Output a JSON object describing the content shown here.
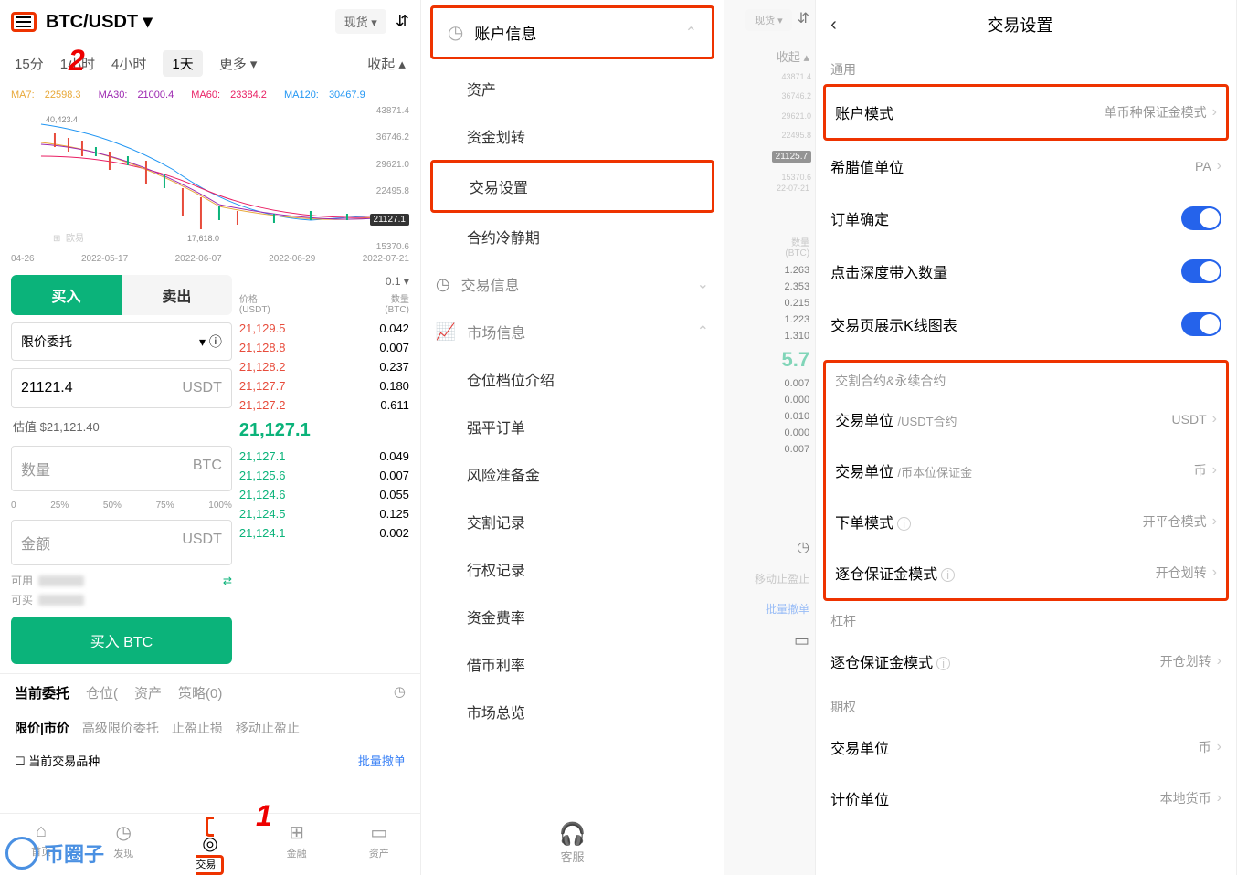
{
  "screen1": {
    "pair": "BTC/USDT ▾",
    "market_type": "现货 ▾",
    "timeframes": [
      "15分",
      "1小时",
      "4小时",
      "1天",
      "更多 ▾"
    ],
    "collapse": "收起 ▴",
    "number_1": "1",
    "number_2": "2",
    "ma": [
      {
        "label": "MA7:",
        "value": "22598.3",
        "color": "#e8a838"
      },
      {
        "label": "MA30:",
        "value": "21000.4",
        "color": "#9c27b0"
      },
      {
        "label": "MA60:",
        "value": "23384.2",
        "color": "#e91e63"
      },
      {
        "label": "MA120:",
        "value": "30467.9",
        "color": "#2196f3"
      }
    ],
    "y_labels": [
      "43871.4",
      "36746.2",
      "29621.0",
      "22495.8",
      "15370.6"
    ],
    "price_tag": "21127.1",
    "chart_high": "40,423.4",
    "chart_low": "17,618.0",
    "watermark_text": "欧易",
    "x_labels": [
      "04-26",
      "2022-05-17",
      "2022-06-07",
      "2022-06-29",
      "2022-07-21"
    ],
    "buy": "买入",
    "sell": "卖出",
    "order_type": "限价委托",
    "price_value": "21121.4",
    "price_unit": "USDT",
    "est_value": "估值 $21,121.40",
    "qty_label": "数量",
    "qty_unit": "BTC",
    "slider_pct": [
      "0",
      "25%",
      "50%",
      "75%",
      "100%"
    ],
    "amount_label": "金额",
    "amount_unit": "USDT",
    "available": "可用",
    "can_buy": "可买",
    "buy_button": "买入 BTC",
    "ob_step": "0.1 ▾",
    "ob_price_label": "价格",
    "ob_price_unit": "(USDT)",
    "ob_qty_label": "数量",
    "ob_qty_unit": "(BTC)",
    "asks": [
      {
        "p": "21,129.5",
        "q": "0.042"
      },
      {
        "p": "21,128.8",
        "q": "0.007"
      },
      {
        "p": "21,128.2",
        "q": "0.237"
      },
      {
        "p": "21,127.7",
        "q": "0.180"
      },
      {
        "p": "21,127.2",
        "q": "0.611"
      }
    ],
    "mid_price": "21,127.1",
    "bids": [
      {
        "p": "21,127.1",
        "q": "0.049"
      },
      {
        "p": "21,125.6",
        "q": "0.007"
      },
      {
        "p": "21,124.6",
        "q": "0.055"
      },
      {
        "p": "21,124.5",
        "q": "0.125"
      },
      {
        "p": "21,124.1",
        "q": "0.002"
      }
    ],
    "bottom_tabs": [
      "当前委托",
      "仓位(",
      "资产",
      "策略(0)"
    ],
    "sub_tabs": [
      "限价|市价",
      "高级限价委托",
      "止盈止损",
      "移动止盈止"
    ],
    "checkbox_label": "当前交易品种",
    "batch_cancel": "批量撤单",
    "nav": [
      {
        "icon": "⌂",
        "label": "首页"
      },
      {
        "icon": "◷",
        "label": "发现"
      },
      {
        "icon": "◎",
        "label": "交易"
      },
      {
        "icon": "⊞",
        "label": "金融"
      },
      {
        "icon": "▭",
        "label": "资产"
      }
    ]
  },
  "screen2": {
    "header": "账户信息",
    "items1": [
      "资产",
      "资金划转",
      "交易设置",
      "合约冷静期"
    ],
    "section2": "交易信息",
    "section3": "市场信息",
    "items3": [
      "仓位档位介绍",
      "强平订单",
      "风险准备金",
      "交割记录",
      "行权记录",
      "资金费率",
      "借币利率",
      "市场总览"
    ],
    "customer_service": "客服"
  },
  "screen3": {
    "market_type": "现货 ▾",
    "collapse": "收起 ▴",
    "y_labels": [
      "43871.4",
      "36746.2",
      "29621.0",
      "22495.8",
      "15370.6"
    ],
    "price_tag": "21125.7",
    "x_label": "22-07-21",
    "ob_qty_label": "数量",
    "ob_qty_unit": "(BTC)",
    "asks": [
      "1.263",
      "2.353",
      "0.215",
      "1.223",
      "1.310"
    ],
    "mid": "5.7",
    "bids": [
      "0.007",
      "0.000",
      "0.010",
      "0.000",
      "0.007"
    ],
    "sub_tab": "移动止盈止",
    "batch_cancel": "批量撤单"
  },
  "screen4": {
    "title": "交易设置",
    "general": "通用",
    "rows1": [
      {
        "label": "账户模式",
        "value": "单币种保证金模式",
        "boxed": true
      },
      {
        "label": "希腊值单位",
        "value": "PA"
      },
      {
        "label": "订单确定",
        "toggle": true
      },
      {
        "label": "点击深度带入数量",
        "toggle": true
      },
      {
        "label": "交易页展示K线图表",
        "toggle": true
      }
    ],
    "section2": "交割合约&永续合约",
    "rows2": [
      {
        "label": "交易单位",
        "sub": "/USDT合约",
        "value": "USDT"
      },
      {
        "label": "交易单位",
        "sub": "/币本位保证金",
        "value": "币"
      },
      {
        "label": "下单模式",
        "info": true,
        "value": "开平仓模式"
      },
      {
        "label": "逐仓保证金模式",
        "info": true,
        "value": "开仓划转"
      }
    ],
    "section3": "杠杆",
    "rows3": [
      {
        "label": "逐仓保证金模式",
        "info": true,
        "value": "开仓划转"
      }
    ],
    "section4": "期权",
    "rows4": [
      {
        "label": "交易单位",
        "value": "币"
      },
      {
        "label": "计价单位",
        "value": "本地货币"
      }
    ]
  },
  "watermark": "币圈子"
}
